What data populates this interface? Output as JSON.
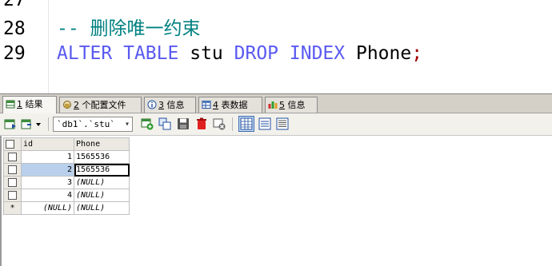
{
  "editor": {
    "lines": [
      {
        "num": "27",
        "text": ""
      },
      {
        "num": "28",
        "text": "-- 删除唯一约束"
      },
      {
        "num": "29",
        "text": "ALTER TABLE stu DROP INDEX Phone;"
      }
    ],
    "tokens": {
      "comment": "-- 删除唯一约束",
      "alter": "ALTER",
      "table": "TABLE",
      "tname": "stu",
      "drop": "DROP",
      "index": "INDEX",
      "col": "Phone",
      "semi": ";"
    }
  },
  "tabs": [
    {
      "num": "1",
      "label": "结果",
      "icon": "results-icon"
    },
    {
      "num": "2",
      "label": "个配置文件",
      "icon": "profiler-icon"
    },
    {
      "num": "3",
      "label": "信息",
      "icon": "info-icon"
    },
    {
      "num": "4",
      "label": "表数据",
      "icon": "table-data-icon"
    },
    {
      "num": "5",
      "label": "信息",
      "icon": "info2-icon"
    }
  ],
  "toolbar": {
    "db_select": "`db1`.`stu`"
  },
  "results": {
    "columns": [
      "id",
      "Phone"
    ],
    "rows": [
      {
        "id": "1",
        "phone": "1565536",
        "phone_null": false
      },
      {
        "id": "2",
        "phone": "1565536",
        "phone_null": false
      },
      {
        "id": "3",
        "phone": "(NULL)",
        "phone_null": true
      },
      {
        "id": "4",
        "phone": "(NULL)",
        "phone_null": true
      }
    ],
    "new_row": {
      "marker": "*",
      "id": "(NULL)",
      "phone": "(NULL)"
    }
  },
  "colors": {
    "keyword": "#5a5af0",
    "comment": "#008080",
    "selection": "#b8d0ec"
  }
}
